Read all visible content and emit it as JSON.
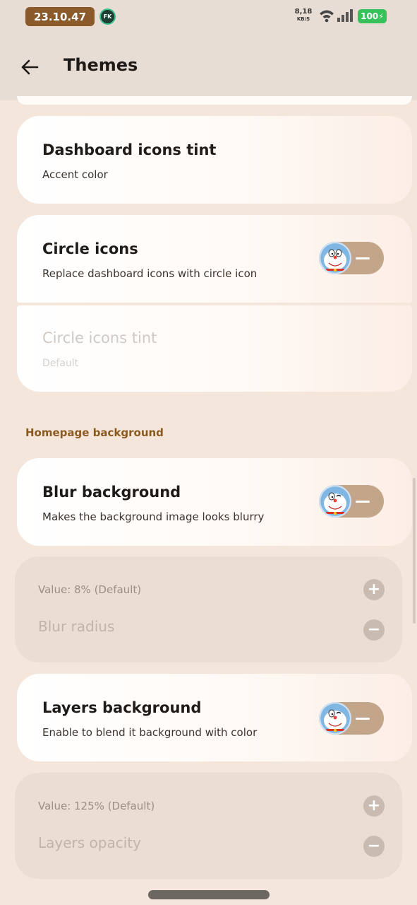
{
  "status_bar": {
    "time": "23.10.47",
    "app_badge": "FK",
    "net_speed": "8,18",
    "net_speed_unit": "KB/S",
    "battery": "100"
  },
  "header": {
    "title": "Themes"
  },
  "settings": {
    "dashboard_tint": {
      "title": "Dashboard icons tint",
      "subtitle": "Accent color"
    },
    "circle_icons": {
      "title": "Circle icons",
      "subtitle": "Replace dashboard icons with circle icon",
      "enabled": true
    },
    "circle_icons_tint": {
      "title": "Circle icons tint",
      "subtitle": "Default",
      "disabled": true
    },
    "homepage_section": "Homepage background",
    "blur_background": {
      "title": "Blur background",
      "subtitle": "Makes the background image looks blurry",
      "enabled": true
    },
    "blur_radius": {
      "value_label": "Value: 8% (Default)",
      "name": "Blur radius"
    },
    "layers_background": {
      "title": "Layers background",
      "subtitle": "Enable to blend it background with color",
      "enabled": true
    },
    "layers_opacity": {
      "value_label": "Value: 125% (Default)",
      "name": "Layers opacity"
    }
  },
  "controls": {
    "increment_symbol": "+",
    "decrement_symbol": "−"
  },
  "colors": {
    "accent": "#8a5a2b",
    "toggle_track": "#c3a58a",
    "background": "#f5e6dc"
  }
}
